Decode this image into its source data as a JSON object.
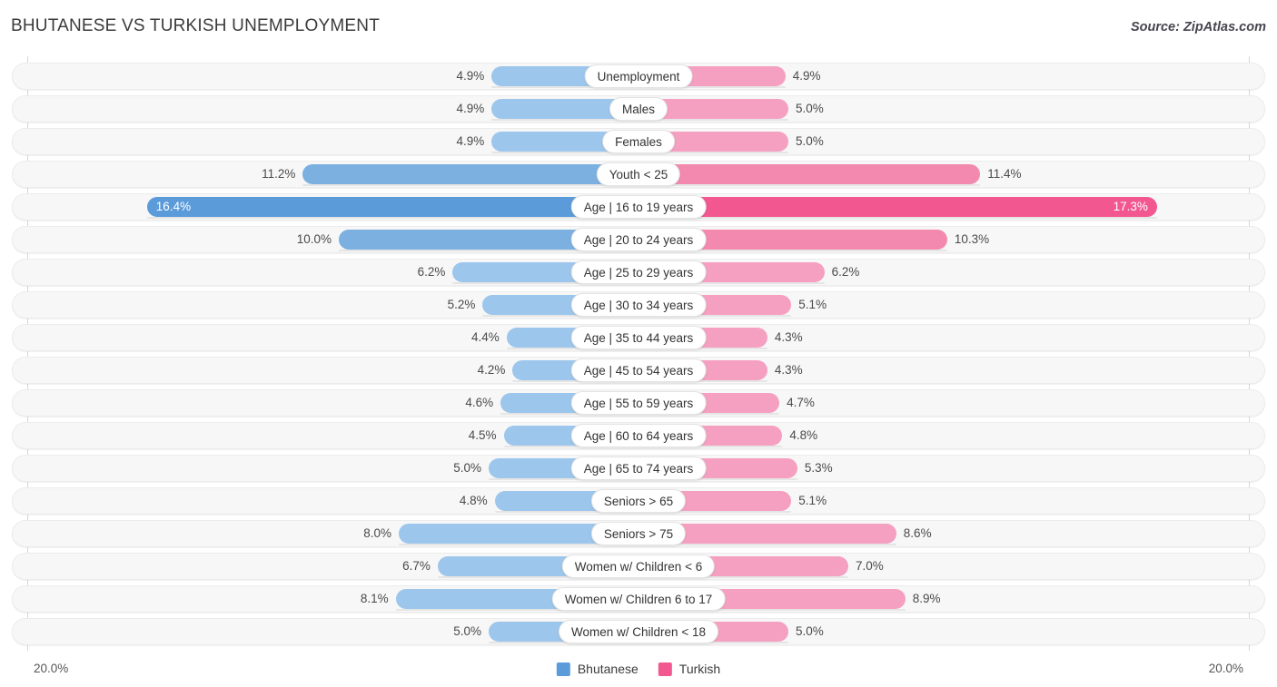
{
  "header": {
    "title": "BHUTANESE VS TURKISH UNEMPLOYMENT",
    "source": "Source: ZipAtlas.com"
  },
  "axis": {
    "left_label": "20.0%",
    "right_label": "20.0%",
    "max": 20.0
  },
  "legend": {
    "items": [
      {
        "label": "Bhutanese",
        "color": "#5b9bd9"
      },
      {
        "label": "Turkish",
        "color": "#f2578f"
      }
    ]
  },
  "colors": {
    "blue_light": "#9dc6ec",
    "blue_mid": "#7cb0e0",
    "blue_dark": "#5b9bd9",
    "pink_light": "#f5a0c0",
    "pink_mid": "#f389ae",
    "pink_dark": "#f2578f",
    "track": "#f7f7f7",
    "track_border": "#ececec",
    "axis": "#d7d7d7"
  },
  "chart_data": {
    "type": "bar",
    "title": "BHUTANESE VS TURKISH UNEMPLOYMENT",
    "subtype": "diverging-bar",
    "xlabel": "",
    "ylabel": "",
    "xlim": [
      20.0,
      20.0
    ],
    "grid": false,
    "legend_position": "bottom-center",
    "categories": [
      "Unemployment",
      "Males",
      "Females",
      "Youth < 25",
      "Age | 16 to 19 years",
      "Age | 20 to 24 years",
      "Age | 25 to 29 years",
      "Age | 30 to 34 years",
      "Age | 35 to 44 years",
      "Age | 45 to 54 years",
      "Age | 55 to 59 years",
      "Age | 60 to 64 years",
      "Age | 65 to 74 years",
      "Seniors > 65",
      "Seniors > 75",
      "Women w/ Children < 6",
      "Women w/ Children 6 to 17",
      "Women w/ Children < 18"
    ],
    "series": [
      {
        "name": "Bhutanese",
        "side": "left",
        "values": [
          4.9,
          4.9,
          4.9,
          11.2,
          16.4,
          10.0,
          6.2,
          5.2,
          4.4,
          4.2,
          4.6,
          4.5,
          5.0,
          4.8,
          8.0,
          6.7,
          8.1,
          5.0
        ],
        "labels": [
          "4.9%",
          "4.9%",
          "4.9%",
          "11.2%",
          "16.4%",
          "10.0%",
          "6.2%",
          "5.2%",
          "4.4%",
          "4.2%",
          "4.6%",
          "4.5%",
          "5.0%",
          "4.8%",
          "8.0%",
          "6.7%",
          "8.1%",
          "5.0%"
        ]
      },
      {
        "name": "Turkish",
        "side": "right",
        "values": [
          4.9,
          5.0,
          5.0,
          11.4,
          17.3,
          10.3,
          6.2,
          5.1,
          4.3,
          4.3,
          4.7,
          4.8,
          5.3,
          5.1,
          8.6,
          7.0,
          8.9,
          5.0
        ],
        "labels": [
          "4.9%",
          "5.0%",
          "5.0%",
          "11.4%",
          "17.3%",
          "10.3%",
          "6.2%",
          "5.1%",
          "4.3%",
          "4.3%",
          "4.7%",
          "4.8%",
          "5.3%",
          "5.1%",
          "8.6%",
          "7.0%",
          "8.9%",
          "5.0%"
        ]
      }
    ]
  }
}
